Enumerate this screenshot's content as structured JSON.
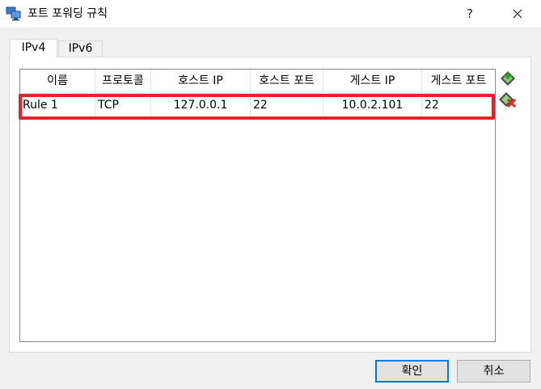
{
  "window": {
    "title": "포트 포워딩 규칙",
    "help_label": "?",
    "close_label": "✕"
  },
  "tabs": [
    {
      "label": "IPv4",
      "selected": true
    },
    {
      "label": "IPv6",
      "selected": false
    }
  ],
  "table": {
    "columns": [
      "이름",
      "프로토콜",
      "호스트 IP",
      "호스트 포트",
      "게스트 IP",
      "게스트 포트"
    ],
    "rows": [
      {
        "name": "Rule 1",
        "protocol": "TCP",
        "host_ip": "127.0.0.1",
        "host_port": "22",
        "guest_ip": "10.0.2.101",
        "guest_port": "22"
      }
    ]
  },
  "buttons": {
    "ok": "확인",
    "cancel": "취소"
  },
  "icons": {
    "app": "network-icon",
    "add": "add-rule-icon",
    "remove": "remove-rule-icon"
  },
  "colors": {
    "highlight": "#e8202a",
    "accent": "#0078d7",
    "add_green": "#3aa52a",
    "remove_red": "#d8302a"
  }
}
